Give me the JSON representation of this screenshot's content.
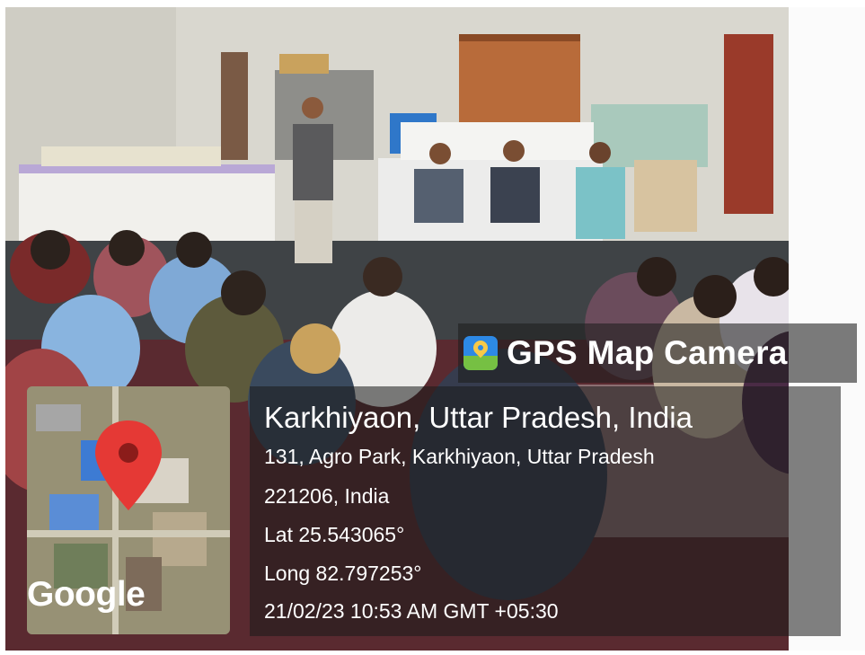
{
  "app": {
    "name": "GPS Map Camera",
    "icon": "gps-map-camera-icon"
  },
  "location": {
    "title": "Karkhiyaon, Uttar Pradesh, India",
    "address_line1": "131, Agro Park, Karkhiyaon, Uttar Pradesh",
    "address_line2": "221206, India",
    "latitude": "Lat 25.543065°",
    "longitude": "Long 82.797253°",
    "timestamp": "21/02/23 10:53 AM GMT +05:30"
  },
  "map": {
    "attribution": "Google",
    "marker_icon": "map-pin-icon",
    "marker_color": "#e53935"
  },
  "colors": {
    "overlay": "#1e1e1e",
    "text": "#ffffff",
    "wall": "#d8d6cf",
    "curtain": "#b86b3a"
  }
}
